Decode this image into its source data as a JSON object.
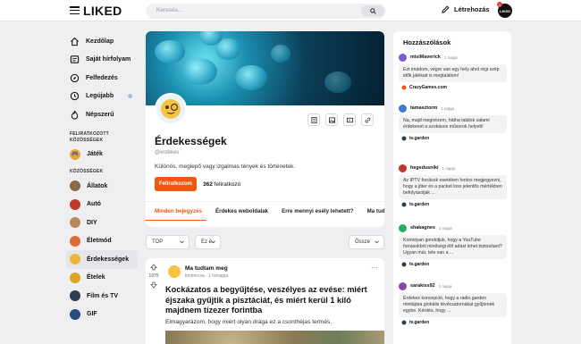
{
  "app": {
    "logo": "LIKED"
  },
  "search": {
    "placeholder": "Keresés..."
  },
  "header": {
    "create_label": "Létrehozás",
    "avatar_text": "LIKED",
    "notif_count": "1"
  },
  "sidebar": {
    "nav": [
      {
        "label": "Kezdőlap",
        "icon": "home-icon"
      },
      {
        "label": "Saját hírfolyam",
        "icon": "feed-icon"
      },
      {
        "label": "Felfedezés",
        "icon": "compass-icon"
      },
      {
        "label": "Legújabb",
        "icon": "clock-icon"
      },
      {
        "label": "Népszerű",
        "icon": "flame-icon"
      }
    ],
    "subscribed_label": "FELIRATKOZOTT KÖZÖSSÉGEK",
    "subscribed": [
      {
        "label": "Játék",
        "color": "#e8a33d"
      }
    ],
    "communities_label": "KÖZÖSSÉGEK",
    "communities": [
      {
        "label": "Állatok",
        "color": "#8a6a4a"
      },
      {
        "label": "Autó",
        "color": "#c0392b"
      },
      {
        "label": "DIY",
        "color": "#b9875a"
      },
      {
        "label": "Életmód",
        "color": "#e06b3a"
      },
      {
        "label": "Érdekességek",
        "color": "#f0b43c"
      },
      {
        "label": "Ételek",
        "color": "#d9a520"
      },
      {
        "label": "Film és TV",
        "color": "#2c3e50"
      },
      {
        "label": "GIF",
        "color": "#2b4c7e"
      }
    ]
  },
  "group": {
    "title": "Érdekességek",
    "handle": "@erdekes",
    "description": "Különös, meglepő vagy izgalmas tények és történetek.",
    "subscribe_label": "Feliratkozom",
    "subscribers_count": "362",
    "subscribers_label": "feliratkozó",
    "tabs": [
      "Minden bejegyzés",
      "Érdekes weboldalak",
      "Erre mennyi esély lehetett?",
      "Ma tudtam"
    ]
  },
  "filters": {
    "sort": "TOP",
    "period": "Ez é",
    "view": "Össze"
  },
  "post": {
    "group": "Ma tudtam meg",
    "author": "timborcsa",
    "time": "1 hónapja",
    "votes": "1975",
    "title": "Kockázatos a begyűjtése, veszélyes az evése: miért éjszaka gyűjtik a pisztáciát, és miért kerül 1 kiló majdnem tízezer forintba",
    "subtitle": "Elmagyarázom, hogy miért olyan drága ez a csonthéjas termés."
  },
  "comments": {
    "title": "Hozzászólások",
    "items": [
      {
        "user": "misiMaverick",
        "time": "1 napja",
        "text": "Ezt imádom, végre van egy hely ahol régi szép idők játékait is megtalálom!",
        "source": "CrazyGames.com",
        "color": "#7b5cd6"
      },
      {
        "user": "tamasztorm",
        "time": "1 napja",
        "text": "Na, majd megnézem, hátha találok valami érdekeset a szokásos műsorok helyett!",
        "source": "tv.garden",
        "color": "#3a7bd5"
      },
      {
        "user": "hegedusniki",
        "time": "1 napja",
        "text": "Az IPTV források esetében fontos megjegyezni, hogy a jitter és a packet loss jelentős mértékben befolyásolják ...",
        "source": "tv.garden",
        "color": "#c0392b"
      },
      {
        "user": "shakagnes",
        "time": "1 napja",
        "text": "Komolyan gondoljuk, hogy a YouTube forrásokból minőségi élő adást lehet biztosítani? Ugyan már, tele van a ...",
        "source": "tv.garden",
        "color": "#27ae60"
      },
      {
        "user": "sarakiss92",
        "time": "1 napja",
        "text": "Érdekes koncepció, hogy a radio.garden mintájára globális tévécsatornákat gyűjtenek egybe. Kérdés, hogy ...",
        "source": "tv.garden",
        "color": "#8e44ad"
      }
    ]
  }
}
